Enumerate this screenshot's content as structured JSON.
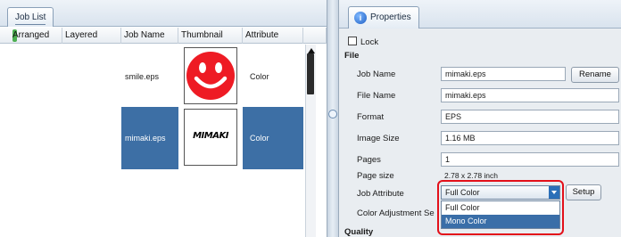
{
  "job_list": {
    "tab_label": "Job List",
    "columns": [
      "Arranged",
      "Layered",
      "Job Name",
      "Thumbnail",
      "Attribute"
    ],
    "rows": [
      {
        "job_name": "smile.eps",
        "thumbnail": "smiley-face-icon",
        "attribute": "Color",
        "selected": false
      },
      {
        "job_name": "mimaki.eps",
        "thumbnail": "mimaki-logo",
        "thumbnail_text": "MIMAKI",
        "attribute": "Color",
        "selected": true
      }
    ]
  },
  "properties": {
    "tab_label": "Properties",
    "lock_label": "Lock",
    "file_section": "File",
    "fields": {
      "job_name": {
        "label": "Job Name",
        "value": "mimaki.eps"
      },
      "file_name": {
        "label": "File Name",
        "value": "mimaki.eps"
      },
      "format": {
        "label": "Format",
        "value": "EPS"
      },
      "image_size": {
        "label": "Image Size",
        "value": "1.16 MB"
      },
      "pages": {
        "label": "Pages",
        "value": "1"
      },
      "page_size": {
        "label": "Page size",
        "value": "2.78 x 2.78 inch"
      },
      "job_attribute": {
        "label": "Job Attribute",
        "value": "Full Color"
      },
      "color_adjustment": {
        "label": "Color Adjustment Se"
      }
    },
    "rename_button": "Rename",
    "setup_button": "Setup",
    "job_attribute_options": [
      "Full Color",
      "Mono Color"
    ],
    "highlighted_option": "Mono Color",
    "quality_section": "Quality"
  },
  "colors": {
    "selection_blue": "#3d6fa5",
    "callout_red": "#e3101a"
  }
}
